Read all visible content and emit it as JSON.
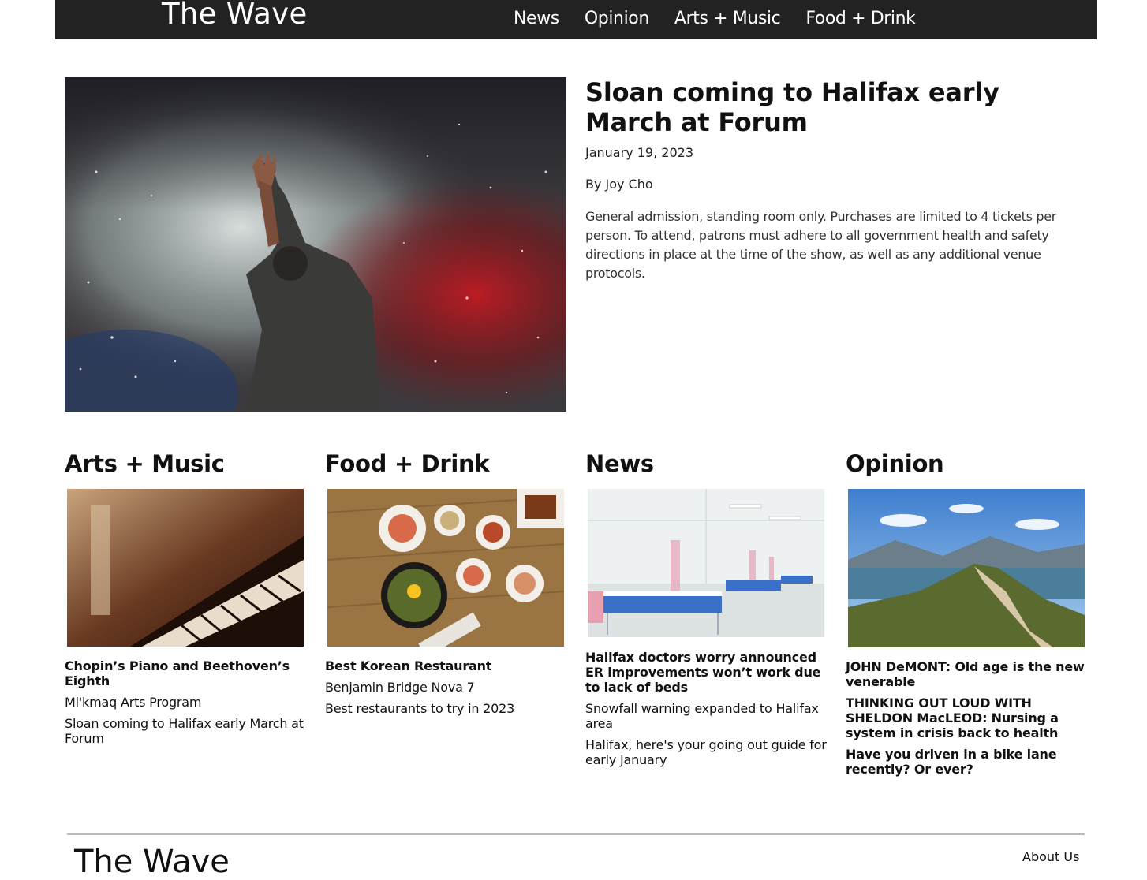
{
  "header": {
    "logo": "The Wave",
    "nav": [
      "News",
      "Opinion",
      "Arts + Music",
      "Food + Drink"
    ]
  },
  "hero": {
    "title": "Sloan coming to Halifax early March at Forum",
    "date": "January 19, 2023",
    "author": "By Joy Cho",
    "summary": "General admission, standing room only. Purchases are limited to 4 tickets per person. To attend, patrons must adhere to all government health and safety directions in place at the time of the show, as well as any additional venue protocols."
  },
  "sections": [
    {
      "title": "Arts + Music",
      "articles": [
        "Chopin’s Piano and Beethoven’s Eighth",
        "Mi'kmaq Arts Program",
        "Sloan coming to Halifax early March at Forum"
      ]
    },
    {
      "title": "Food + Drink",
      "articles": [
        "Best Korean Restaurant",
        "Benjamin Bridge Nova 7",
        "Best restaurants to try in 2023"
      ]
    },
    {
      "title": "News",
      "articles": [
        "Halifax doctors worry announced ER improvements won’t work due to lack of beds",
        "Snowfall warning expanded to Halifax area",
        "Halifax, here's your going out guide for early January"
      ]
    },
    {
      "title": "Opinion",
      "articles": [
        "JOHN DeMONT: Old age is the new venerable",
        "THINKING OUT LOUD WITH SHELDON MacLEOD: Nursing a system in crisis back to health",
        "Have you driven in a bike lane recently? Or ever?"
      ]
    }
  ],
  "footer": {
    "logo": "The Wave",
    "link": "About Us"
  }
}
